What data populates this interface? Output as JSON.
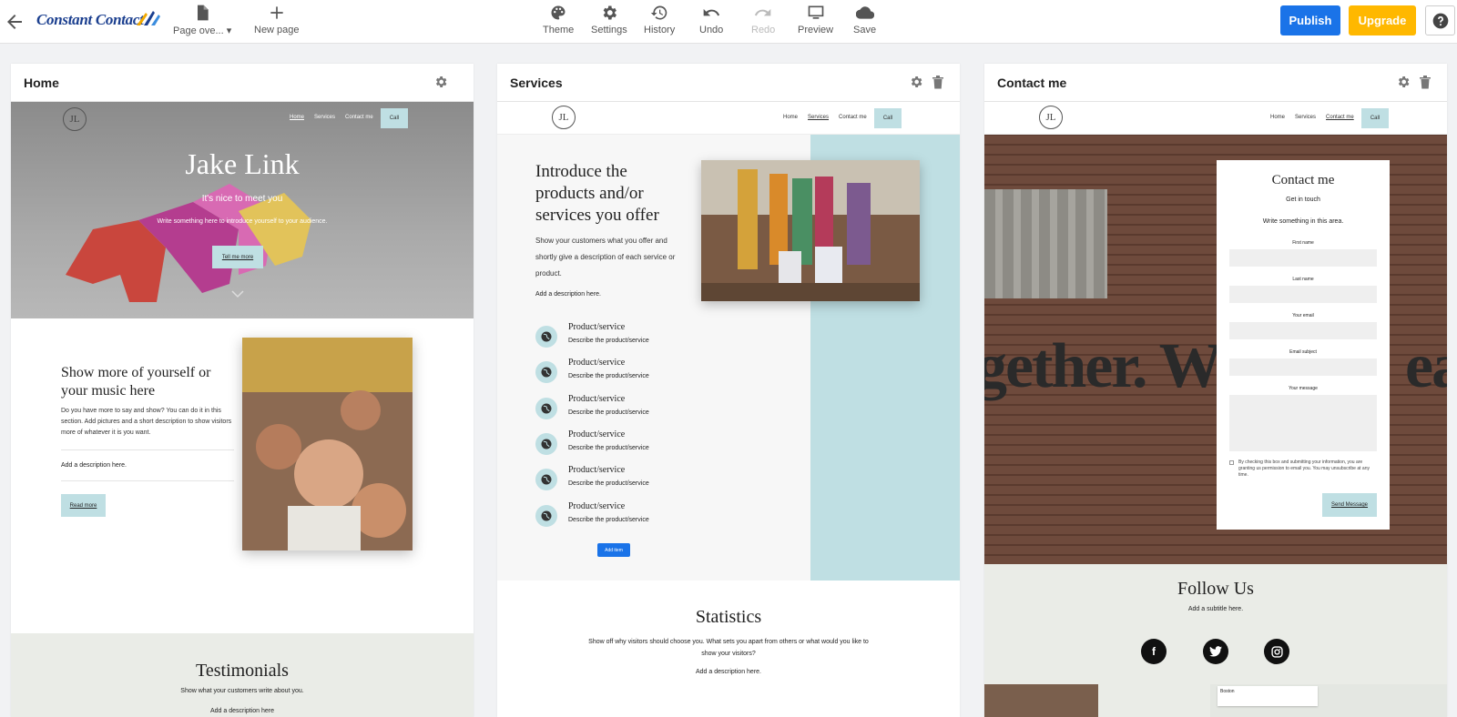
{
  "topbar": {
    "logo_text": "Constant Contact",
    "page_overview": "Page ove...",
    "new_page": "New page",
    "theme": "Theme",
    "settings": "Settings",
    "history": "History",
    "undo": "Undo",
    "redo": "Redo",
    "preview": "Preview",
    "save": "Save",
    "publish": "Publish",
    "upgrade": "Upgrade"
  },
  "home": {
    "card_title": "Home",
    "logo": "JL",
    "nav": [
      "Home",
      "Services",
      "Contact me"
    ],
    "call": "Call",
    "hero_title": "Jake Link",
    "hero_subtitle": "It's nice to meet you",
    "hero_text": "Write something here to introduce yourself to your audience.",
    "hero_button": "Tell me more",
    "section_title": "Show more of yourself or your music here",
    "section_text": "Do you have more to say and show? You can do it in this section. Add pictures and a short description to show visitors more of whatever it is you want.",
    "section_desc": "Add a description here.",
    "read_more": "Read more",
    "testimonials_title": "Testimonials",
    "testimonials_sub": "Show what your customers write about you.",
    "testimonials_desc": "Add a description here"
  },
  "services": {
    "card_title": "Services",
    "logo": "JL",
    "nav": [
      "Home",
      "Services",
      "Contact me"
    ],
    "call": "Call",
    "title": "Introduce the products and/or services you offer",
    "text": "Show your customers what you offer and shortly give a description of each service or product.",
    "desc": "Add a description here.",
    "items": [
      {
        "title": "Product/service",
        "desc": "Describe the product/service"
      },
      {
        "title": "Product/service",
        "desc": "Describe the product/service"
      },
      {
        "title": "Product/service",
        "desc": "Describe the product/service"
      },
      {
        "title": "Product/service",
        "desc": "Describe the product/service"
      },
      {
        "title": "Product/service",
        "desc": "Describe the product/service"
      },
      {
        "title": "Product/service",
        "desc": "Describe the product/service"
      }
    ],
    "add_item": "Add item",
    "stats_title": "Statistics",
    "stats_text": "Show off why visitors should choose you. What sets you apart from others or what would you like to show your visitors?",
    "stats_desc": "Add a description here."
  },
  "contact": {
    "card_title": "Contact me",
    "logo": "JL",
    "nav": [
      "Home",
      "Services",
      "Contact me"
    ],
    "call": "Call",
    "graffiti": "gether. W",
    "graffiti_end": "ea",
    "form_title": "Contact me",
    "form_sub": "Get in touch",
    "form_text": "Write something in this area.",
    "first_name": "First name",
    "last_name": "Last name",
    "email": "Your email",
    "subject": "Email subject",
    "message": "Your message",
    "consent": "By checking this box and submitting your information, you are granting us permission to email you. You may unsubscribe at any time.",
    "send": "Send Message",
    "follow_title": "Follow Us",
    "follow_sub": "Add a subtitle here.",
    "map_label": "Boston"
  }
}
